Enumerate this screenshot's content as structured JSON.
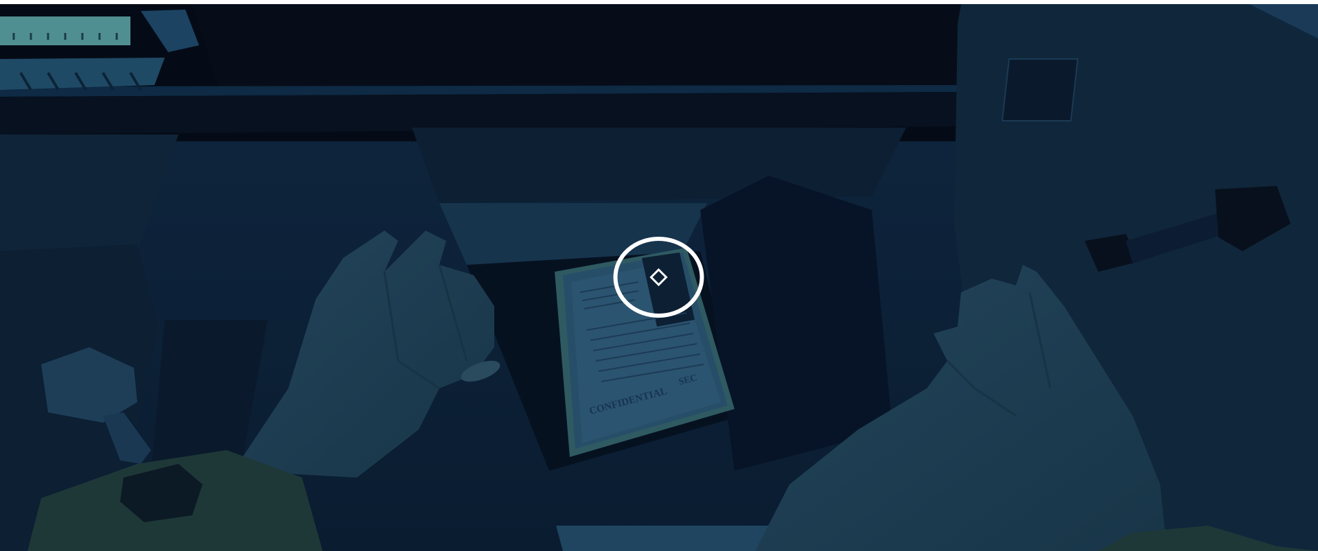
{
  "game": {
    "scene": "car-interior-first-person-night",
    "document": {
      "stamp": "CONFIDENTIAL",
      "corner_label": "SEC"
    },
    "crosshair": {
      "icon": "diamond-crosshair-icon",
      "ring_color": "#ffffff"
    },
    "palette": {
      "night_sky": "#050b16",
      "interior": "#0d2238",
      "skin": "#1d3a4f",
      "sleeve": "#1f3b3a",
      "paper": "#2a4d66"
    }
  }
}
